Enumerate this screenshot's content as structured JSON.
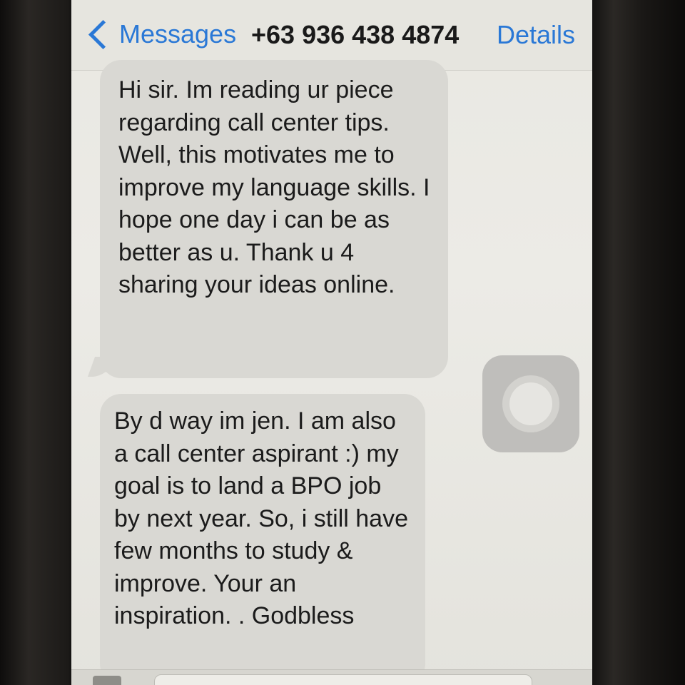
{
  "navbar": {
    "back_label": "Messages",
    "title": "+63 936 438 4874",
    "details_label": "Details"
  },
  "messages": [
    {
      "direction": "incoming",
      "text": "Hi sir. Im reading ur piece regarding call center tips. Well, this motivates me to improve my language skills. I hope one day i can be as better as u. Thank u 4 sharing your ideas online."
    },
    {
      "direction": "incoming",
      "text": "By d way im jen. I am also a call center aspirant :) my goal is to land a BPO job by next year. So, i still have few months to study & improve. Your an inspiration. . Godbless"
    }
  ],
  "composer": {
    "placeholder": ""
  },
  "colors": {
    "accent": "#2a78d6",
    "incoming_bubble": "#d9d8d3",
    "screen_background": "#ecebe6"
  },
  "icons": {
    "back": "chevron-left-icon",
    "assistive_touch": "assistive-touch-icon",
    "camera": "camera-icon"
  }
}
